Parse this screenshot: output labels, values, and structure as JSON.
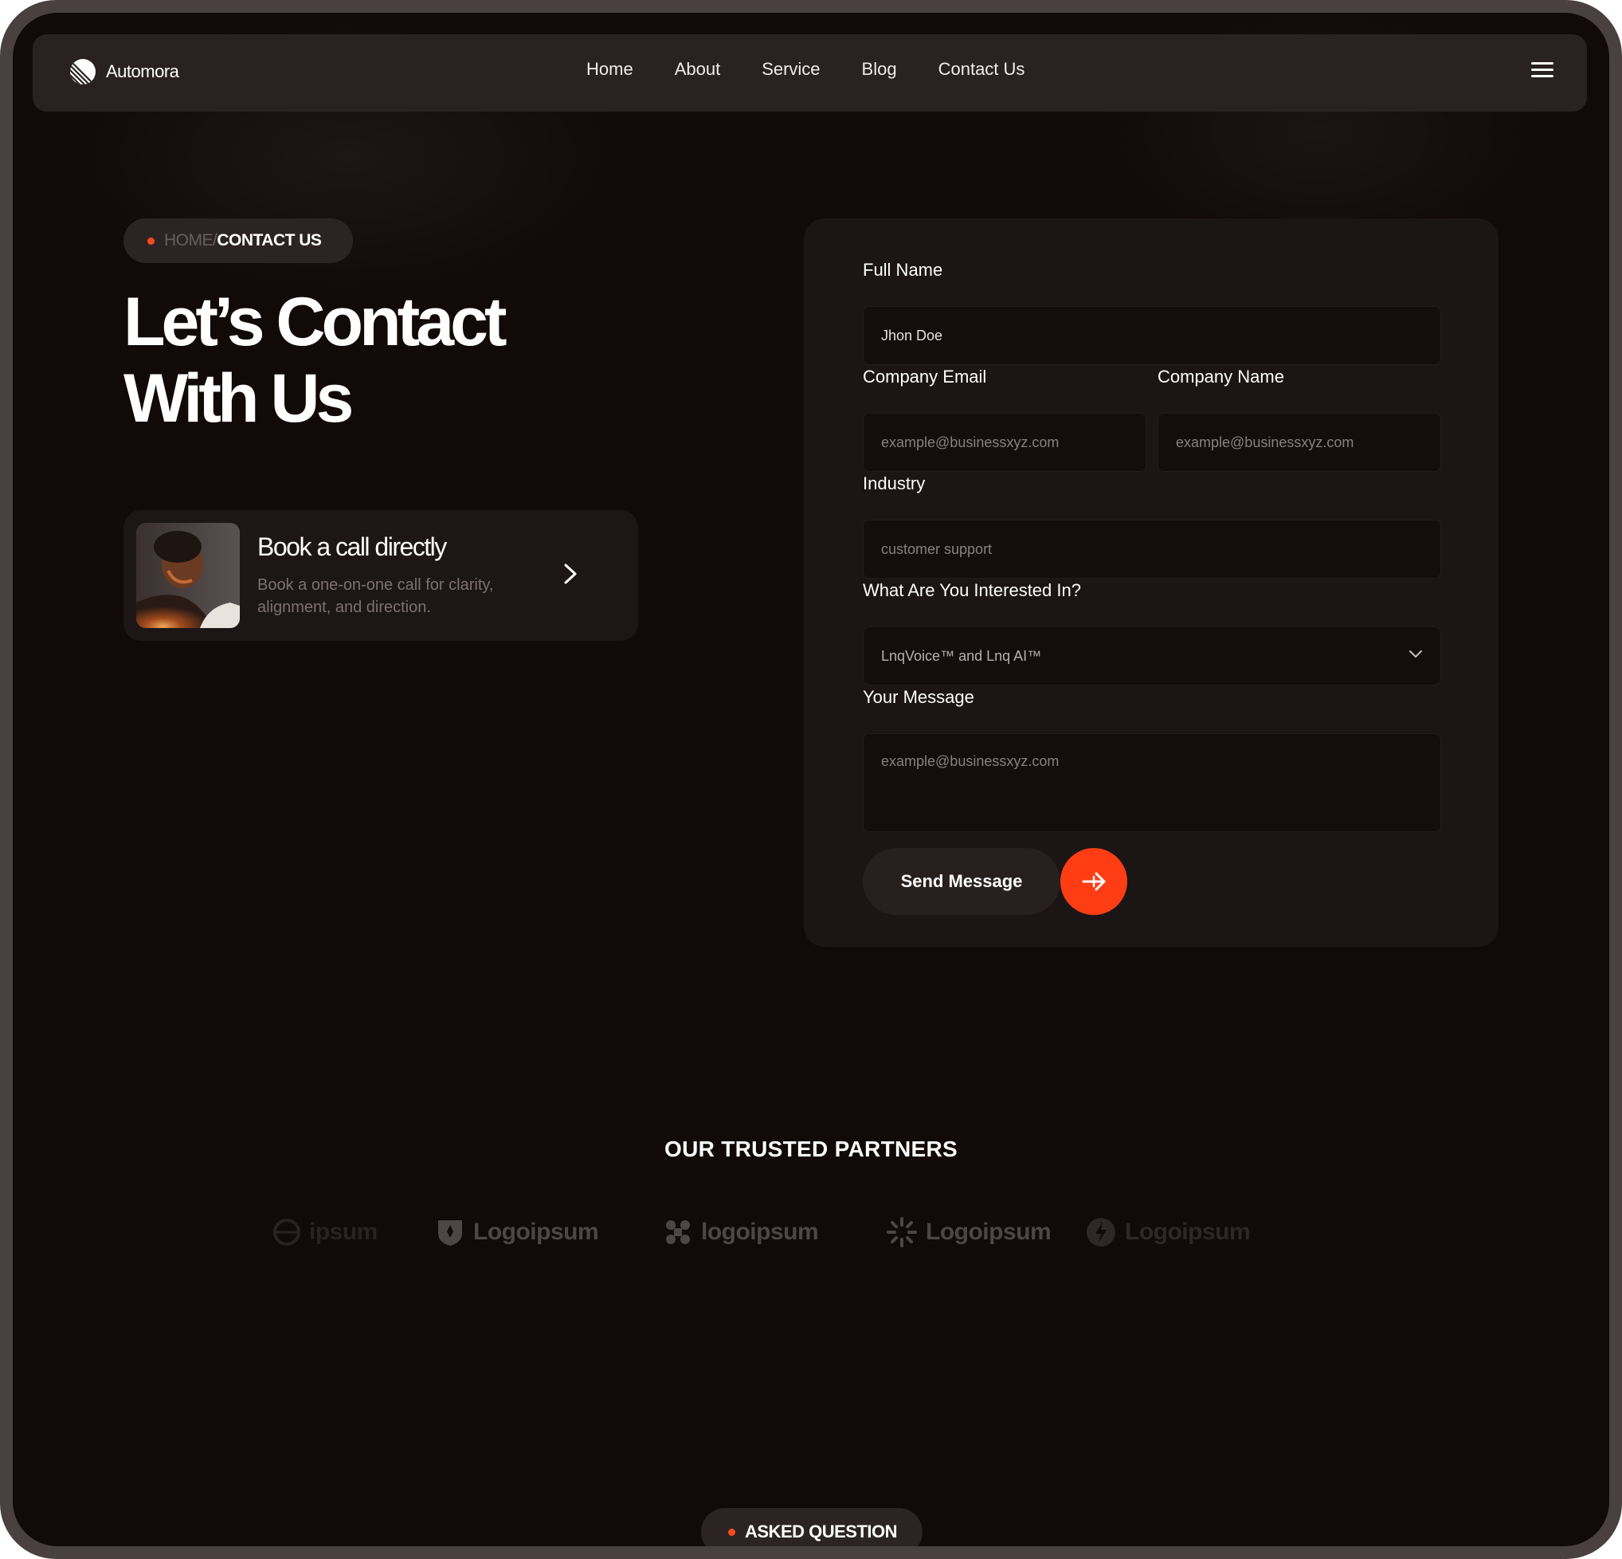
{
  "nav": {
    "brand": "Automora",
    "links": [
      "Home",
      "About",
      "Service",
      "Blog",
      "Contact Us"
    ],
    "menu_icon": "hamburger-icon"
  },
  "breadcrumb": {
    "home": "HOME/",
    "current": "CONTACT US"
  },
  "hero": {
    "title_line1": "Let’s Contact",
    "title_line2": "With Us"
  },
  "book_call": {
    "title": "Book a call directly",
    "description": "Book a one-on-one call for clarity, alignment, and direction.",
    "arrow_icon": "chevron-right-icon"
  },
  "form": {
    "full_name_label": "Full Name",
    "full_name_value": "Jhon Doe",
    "company_email_label": "Company Email",
    "company_email_placeholder": "example@businessxyz.com",
    "company_name_label": "Company Name",
    "company_name_placeholder": "example@businessxyz.com",
    "industry_label": "Industry",
    "industry_placeholder": "customer support",
    "interest_label": "What Are You Interested In?",
    "interest_value": "LnqVoice™ and Lnq AI™",
    "message_label": "Your Message",
    "message_placeholder": "example@businessxyz.com",
    "send_label": "Send Message"
  },
  "partners": {
    "title": "OUR TRUSTED PARTNERS",
    "logos": [
      "ipsum",
      "Logoipsum",
      "logoipsum",
      "Logoipsum",
      "Logoipsum"
    ]
  },
  "faq": {
    "label": "ASKED QUESTION"
  },
  "colors": {
    "accent": "#ff3d14",
    "background": "#120909",
    "card": "#1c1515"
  }
}
